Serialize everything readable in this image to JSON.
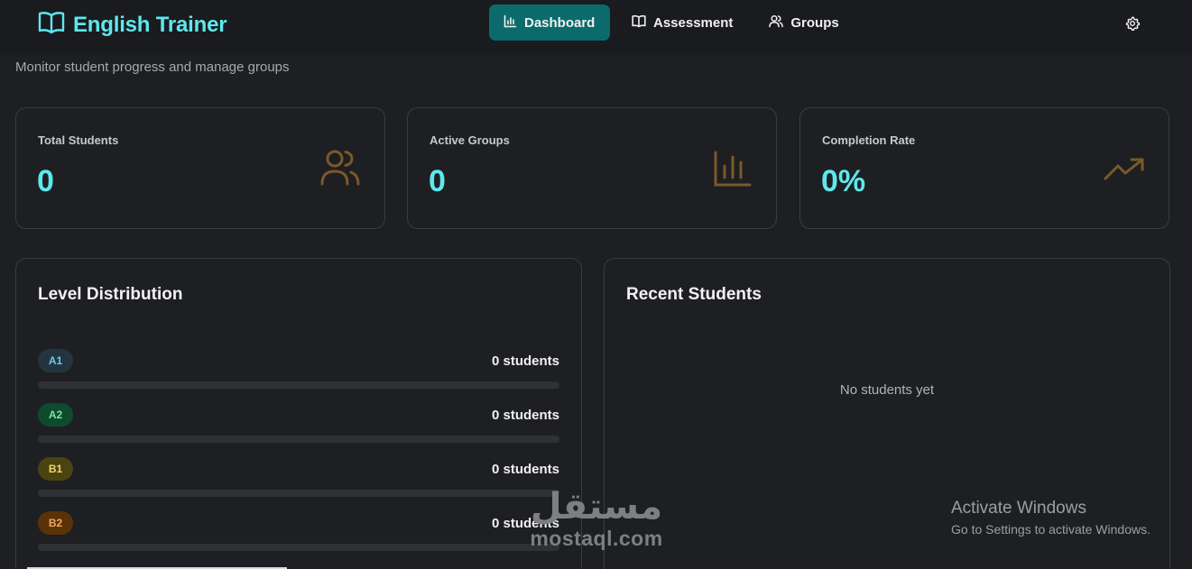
{
  "app": {
    "title": "English Trainer",
    "subtitle": "Monitor student progress and manage groups"
  },
  "nav": {
    "items": [
      {
        "label": "Dashboard",
        "icon": "bar-chart-icon",
        "active": true
      },
      {
        "label": "Assessment",
        "icon": "book-icon",
        "active": false
      },
      {
        "label": "Groups",
        "icon": "users-icon",
        "active": false
      }
    ],
    "settings_icon": "gear-icon"
  },
  "stats": [
    {
      "label": "Total Students",
      "value": "0",
      "icon": "users-icon"
    },
    {
      "label": "Active Groups",
      "value": "0",
      "icon": "bar-chart-icon"
    },
    {
      "label": "Completion Rate",
      "value": "0%",
      "icon": "trending-up-icon"
    }
  ],
  "level_distribution": {
    "title": "Level Distribution",
    "levels": [
      {
        "code": "A1",
        "count": "0 students",
        "progress": 0,
        "bg": "#243542",
        "fg": "#6ec5f0"
      },
      {
        "code": "A2",
        "count": "0 students",
        "progress": 0,
        "bg": "#0f4a2d",
        "fg": "#7fe3a6"
      },
      {
        "code": "B1",
        "count": "0 students",
        "progress": 0,
        "bg": "#4a4410",
        "fg": "#f0d36a"
      },
      {
        "code": "B2",
        "count": "0 students",
        "progress": 0,
        "bg": "#5a3208",
        "fg": "#f5a857"
      }
    ]
  },
  "recent_students": {
    "title": "Recent Students",
    "empty": "No students yet"
  },
  "os_overlay": {
    "title": "Activate Windows",
    "subtitle": "Go to Settings to activate Windows."
  },
  "watermark": {
    "arabic": "مستقل",
    "latin": "mostaql.com"
  },
  "colors": {
    "accent": "#5ee8ee",
    "active_nav": "#0b6b6c",
    "icon_brown": "#7a5a2b",
    "background": "#1e1f22"
  }
}
